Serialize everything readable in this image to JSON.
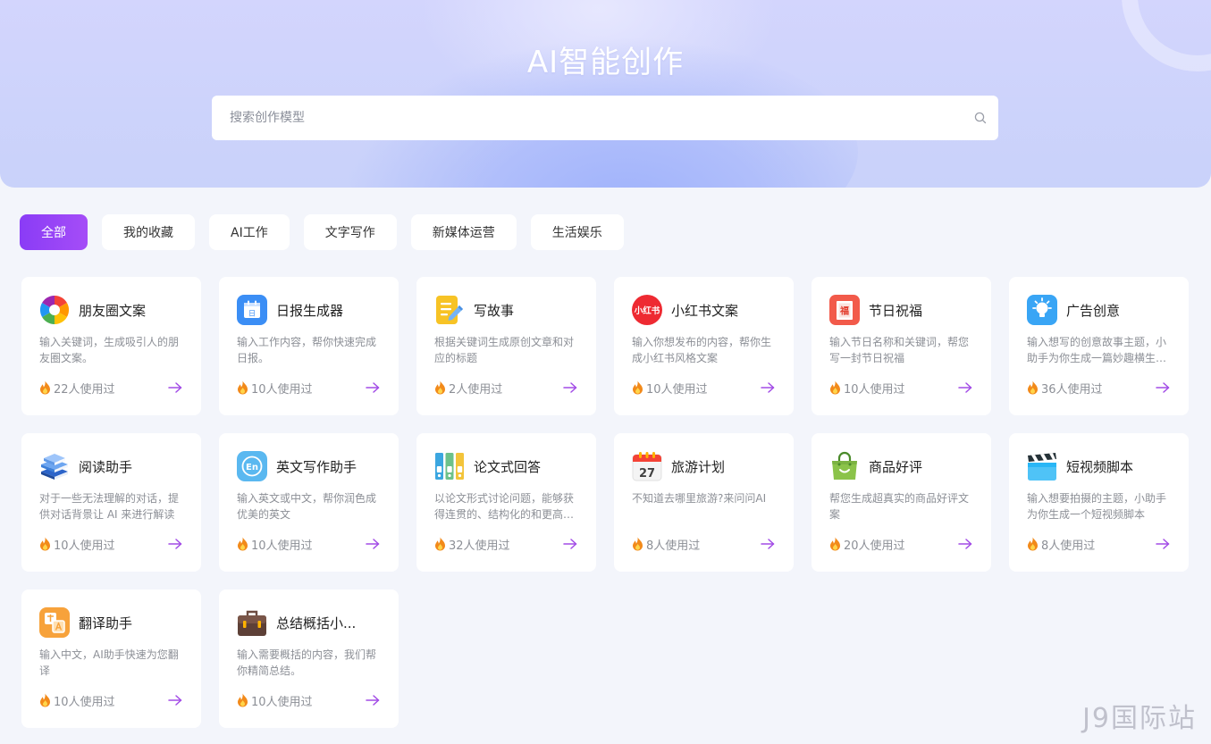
{
  "hero": {
    "title": "AI智能创作",
    "search_placeholder": "搜索创作模型"
  },
  "tabs": [
    {
      "label": "全部",
      "active": true
    },
    {
      "label": "我的收藏",
      "active": false
    },
    {
      "label": "AI工作",
      "active": false
    },
    {
      "label": "文字写作",
      "active": false
    },
    {
      "label": "新媒体运营",
      "active": false
    },
    {
      "label": "生活娱乐",
      "active": false
    }
  ],
  "cards": [
    {
      "icon": "aperture-icon",
      "title": "朋友圈文案",
      "desc": "输入关键词，生成吸引人的朋友圈文案。",
      "usage": "22人使用过"
    },
    {
      "icon": "calendar-day-icon",
      "title": "日报生成器",
      "desc": "输入工作内容，帮你快速完成日报。",
      "usage": "10人使用过"
    },
    {
      "icon": "document-pencil-icon",
      "title": "写故事",
      "desc": "根据关键词生成原创文章和对应的标题",
      "usage": "2人使用过"
    },
    {
      "icon": "xiaohongshu-icon",
      "title": "小红书文案",
      "desc": "输入你想发布的内容，帮你生成小红书风格文案",
      "usage": "10人使用过"
    },
    {
      "icon": "blessing-icon",
      "title": "节日祝福",
      "desc": "输入节日名称和关键词，帮您写一封节日祝福",
      "usage": "10人使用过"
    },
    {
      "icon": "lightbulb-icon",
      "title": "广告创意",
      "desc": "输入想写的创意故事主题，小助手为你生成一篇妙趣横生的广告创意",
      "usage": "36人使用过"
    },
    {
      "icon": "books-icon",
      "title": "阅读助手",
      "desc": "对于一些无法理解的对话，提供对话背景让 AI 来进行解读",
      "usage": "10人使用过"
    },
    {
      "icon": "english-icon",
      "title": "英文写作助手",
      "desc": "输入英文或中文，帮你润色成优美的英文",
      "usage": "10人使用过"
    },
    {
      "icon": "binders-icon",
      "title": "论文式回答",
      "desc": "以论文形式讨论问题，能够获得连贯的、结构化的和更高质量的回答",
      "usage": "32人使用过"
    },
    {
      "icon": "calendar-27-icon",
      "title": "旅游计划",
      "desc": "不知道去哪里旅游?来问问AI",
      "usage": "8人使用过"
    },
    {
      "icon": "shopping-bag-icon",
      "title": "商品好评",
      "desc": "帮您生成超真实的商品好评文案",
      "usage": "20人使用过"
    },
    {
      "icon": "clapperboard-icon",
      "title": "短视频脚本",
      "desc": "输入想要拍摄的主题，小助手为你生成一个短视频脚本",
      "usage": "8人使用过"
    },
    {
      "icon": "translate-icon",
      "title": "翻译助手",
      "desc": "输入中文，AI助手快速为您翻译",
      "usage": "10人使用过"
    },
    {
      "icon": "briefcase-icon",
      "title": "总结概括小...",
      "desc": "输入需要概括的内容，我们帮你精简总结。",
      "usage": "10人使用过"
    }
  ],
  "watermark": "J9国际站",
  "icon_glyphs": {
    "xiaohongshu": "小红书",
    "blessing": "福",
    "calendar_day": "日",
    "english": "En",
    "calendar_number": "27"
  },
  "colors": {
    "accent": "#9b45f7",
    "arrow": "#a24be6",
    "fire": "#f28a1a"
  }
}
